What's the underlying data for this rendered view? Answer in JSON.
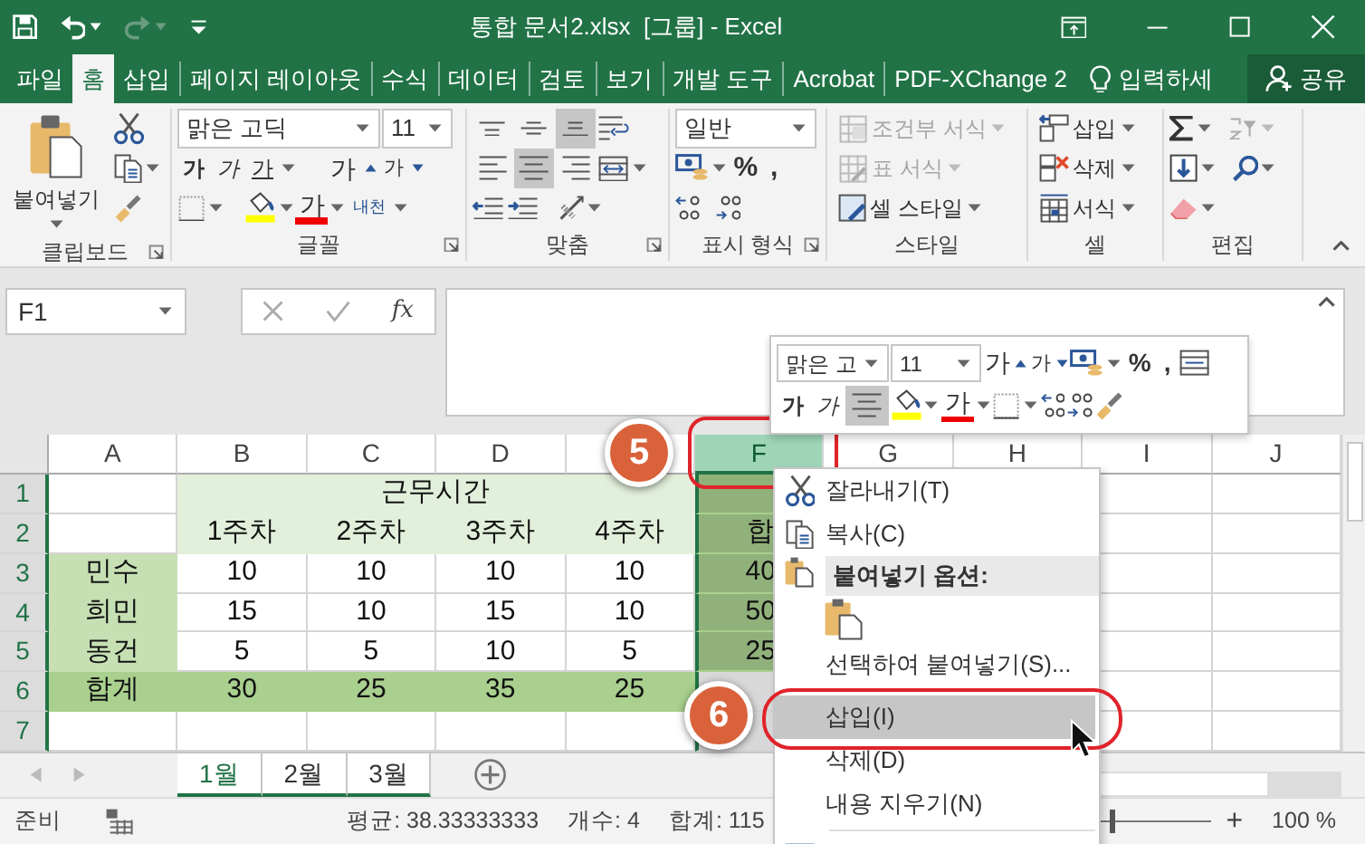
{
  "window": {
    "title": "통합 문서2.xlsx  [그룹] - Excel"
  },
  "ribbon_tabs": [
    {
      "label": "파일",
      "selected": false
    },
    {
      "label": "홈",
      "selected": true
    },
    {
      "label": "삽입",
      "selected": false
    },
    {
      "label": "페이지 레이아웃",
      "selected": false
    },
    {
      "label": "수식",
      "selected": false
    },
    {
      "label": "데이터",
      "selected": false
    },
    {
      "label": "검토",
      "selected": false
    },
    {
      "label": "보기",
      "selected": false
    },
    {
      "label": "개발 도구",
      "selected": false
    },
    {
      "label": "Acrobat",
      "selected": false
    },
    {
      "label": "PDF-XChange 2",
      "selected": false
    }
  ],
  "tell_me": "입력하세",
  "share": "공유",
  "clipboard": {
    "paste": "붙여넣기",
    "label": "클립보드"
  },
  "font": {
    "name": "맑은 고딕",
    "size": "11",
    "bold": "가",
    "italic": "가",
    "underline": "가",
    "grow": "가",
    "shrink": "가",
    "font_color": "가",
    "phonetic": "내천",
    "label": "글꼴"
  },
  "alignment": {
    "vertical": [
      {
        "kind": "top",
        "selected": false
      },
      {
        "kind": "middle",
        "selected": false
      },
      {
        "kind": "bottom",
        "selected": true
      }
    ],
    "horizontal": [
      {
        "kind": "left",
        "selected": false
      },
      {
        "kind": "center",
        "selected": true
      },
      {
        "kind": "right",
        "selected": false
      }
    ],
    "label": "맞춤"
  },
  "number": {
    "format": "일반",
    "percent": "%",
    "comma": ",",
    "label": "표시 형식"
  },
  "styles": {
    "items": [
      {
        "kind": "conditional",
        "label": "조건부 서식",
        "disabled": true
      },
      {
        "kind": "table",
        "label": "표 서식",
        "disabled": true
      },
      {
        "kind": "cell",
        "label": "셀 스타일",
        "disabled": false
      }
    ],
    "label": "스타일"
  },
  "cells": {
    "items": [
      {
        "kind": "insert",
        "label": "삽입"
      },
      {
        "kind": "delete",
        "label": "삭제"
      },
      {
        "kind": "format",
        "label": "서식"
      }
    ],
    "label": "셀"
  },
  "editing": {
    "label": "편집"
  },
  "formula_bar": {
    "name_box": "F1",
    "fx": "fx"
  },
  "mini_toolbar": {
    "font": "맑은 고",
    "size": "11",
    "grow": "가",
    "shrink": "가",
    "percent": "%",
    "comma": ",",
    "bold": "가",
    "italic": "가",
    "align_center": {
      "selected": true
    },
    "font_color": "가"
  },
  "columns": [
    {
      "label": "A",
      "selected": false
    },
    {
      "label": "B",
      "selected": false
    },
    {
      "label": "C",
      "selected": false
    },
    {
      "label": "D",
      "selected": false
    },
    {
      "selected": false
    },
    {
      "label": "F",
      "selected": true
    },
    {
      "label": "G",
      "selected": false
    },
    {
      "label": "H",
      "selected": false
    },
    {
      "label": "I",
      "selected": false
    },
    {
      "label": "J",
      "selected": false
    }
  ],
  "rows": [
    {
      "header": "1",
      "selected": true,
      "cells": [
        {
          "kind": "blank"
        },
        {
          "kind": "title",
          "text": "근무시간",
          "merge_across": true
        },
        {
          "kind": "total"
        },
        {
          "kind": "blank"
        },
        {
          "kind": "blank"
        },
        {
          "kind": "blank"
        },
        {
          "kind": "blank"
        }
      ]
    },
    {
      "header": "2",
      "selected": true,
      "cells": [
        {
          "kind": "blank"
        },
        {
          "kind": "title",
          "text": "1주차"
        },
        {
          "kind": "title",
          "text": "2주차"
        },
        {
          "kind": "title",
          "text": "3주차"
        },
        {
          "kind": "title",
          "text": "4주차"
        },
        {
          "kind": "total",
          "text": "합"
        },
        {
          "kind": "blank"
        },
        {
          "kind": "blank"
        },
        {
          "kind": "blank"
        },
        {
          "kind": "blank"
        }
      ]
    },
    {
      "header": "3",
      "selected": true,
      "cells": [
        {
          "kind": "name",
          "text": "민수"
        },
        {
          "kind": "blank",
          "text": "10"
        },
        {
          "kind": "blank",
          "text": "10"
        },
        {
          "kind": "blank",
          "text": "10"
        },
        {
          "kind": "blank",
          "text": "10"
        },
        {
          "kind": "total",
          "text": "40"
        },
        {
          "kind": "blank"
        },
        {
          "kind": "blank"
        },
        {
          "kind": "blank"
        },
        {
          "kind": "blank"
        }
      ]
    },
    {
      "header": "4",
      "selected": true,
      "cells": [
        {
          "kind": "name",
          "text": "희민"
        },
        {
          "kind": "blank",
          "text": "15"
        },
        {
          "kind": "blank",
          "text": "10"
        },
        {
          "kind": "blank",
          "text": "15"
        },
        {
          "kind": "blank",
          "text": "10"
        },
        {
          "kind": "total",
          "text": "50"
        },
        {
          "kind": "blank"
        },
        {
          "kind": "blank"
        },
        {
          "kind": "blank"
        },
        {
          "kind": "blank"
        }
      ]
    },
    {
      "header": "5",
      "selected": true,
      "cells": [
        {
          "kind": "name",
          "text": "동건"
        },
        {
          "kind": "blank",
          "text": "5"
        },
        {
          "kind": "blank",
          "text": "5"
        },
        {
          "kind": "blank",
          "text": "10"
        },
        {
          "kind": "blank",
          "text": "5"
        },
        {
          "kind": "total",
          "text": "25"
        },
        {
          "kind": "blank"
        },
        {
          "kind": "blank"
        },
        {
          "kind": "blank"
        },
        {
          "kind": "blank"
        }
      ]
    },
    {
      "header": "6",
      "selected": true,
      "cells": [
        {
          "kind": "total",
          "text": "합계"
        },
        {
          "kind": "total",
          "text": "30"
        },
        {
          "kind": "total",
          "text": "25"
        },
        {
          "kind": "total",
          "text": "35"
        },
        {
          "kind": "total",
          "text": "25"
        },
        {
          "kind": "blank"
        },
        {
          "kind": "blank"
        },
        {
          "kind": "blank"
        },
        {
          "kind": "blank"
        },
        {
          "kind": "blank"
        }
      ]
    },
    {
      "header": "7",
      "selected": true,
      "cells": [
        {
          "kind": "blank"
        },
        {
          "kind": "blank"
        },
        {
          "kind": "blank"
        },
        {
          "kind": "blank"
        },
        {
          "kind": "blank"
        },
        {
          "kind": "blank"
        },
        {
          "kind": "blank"
        },
        {
          "kind": "blank"
        },
        {
          "kind": "blank"
        },
        {
          "kind": "blank"
        }
      ]
    }
  ],
  "sheet_tabs": [
    {
      "label": "1월",
      "selected": true
    },
    {
      "label": "2월",
      "selected": false
    },
    {
      "label": "3월",
      "selected": false
    }
  ],
  "context_menu": [
    {
      "kind": "cut",
      "label": "잘라내기(T)",
      "selected": false
    },
    {
      "kind": "copy",
      "label": "복사(C)",
      "selected": false
    },
    {
      "kind": "header",
      "label": "붙여넣기 옵션:"
    },
    {
      "kind": "paste",
      "selected": false
    },
    {
      "kind": "plain",
      "label": "선택하여 붙여넣기(S)...",
      "selected": false
    },
    {
      "kind": "plain",
      "label": "삽입(I)",
      "selected": true,
      "separator": true
    },
    {
      "kind": "plain",
      "label": "삭제(D)",
      "selected": false
    },
    {
      "kind": "plain",
      "label": "내용 지우기(N)",
      "selected": false
    },
    {
      "kind": "format",
      "selected": false,
      "separator": true
    }
  ],
  "annotations": [
    {
      "text": "5"
    },
    {
      "text": "6"
    }
  ],
  "status_bar": {
    "mode": "준비",
    "average": "평균: 38.33333333",
    "count": "개수: 4",
    "sum": "합계: 115",
    "zoom_slider": {
      "level": 0.5
    },
    "zoom_in": "+",
    "zoom": "100 %"
  }
}
